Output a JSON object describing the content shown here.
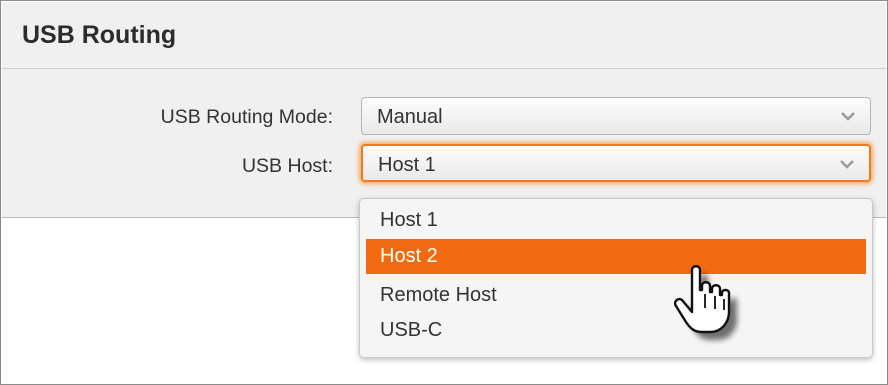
{
  "panel": {
    "title": "USB Routing"
  },
  "fields": {
    "routing_mode": {
      "label": "USB Routing Mode:",
      "value": "Manual"
    },
    "usb_host": {
      "label": "USB Host:",
      "value": "Host 1"
    }
  },
  "dropdown": {
    "options": [
      "Host 1",
      "Host 2",
      "Remote Host",
      "USB-C"
    ],
    "highlighted": "Host 2"
  },
  "colors": {
    "accent": "#f26a10",
    "focus_glow": "#f07a1c"
  },
  "icons": {
    "chevron": "chevron-down-icon",
    "cursor": "hand-pointer-cursor-icon"
  }
}
